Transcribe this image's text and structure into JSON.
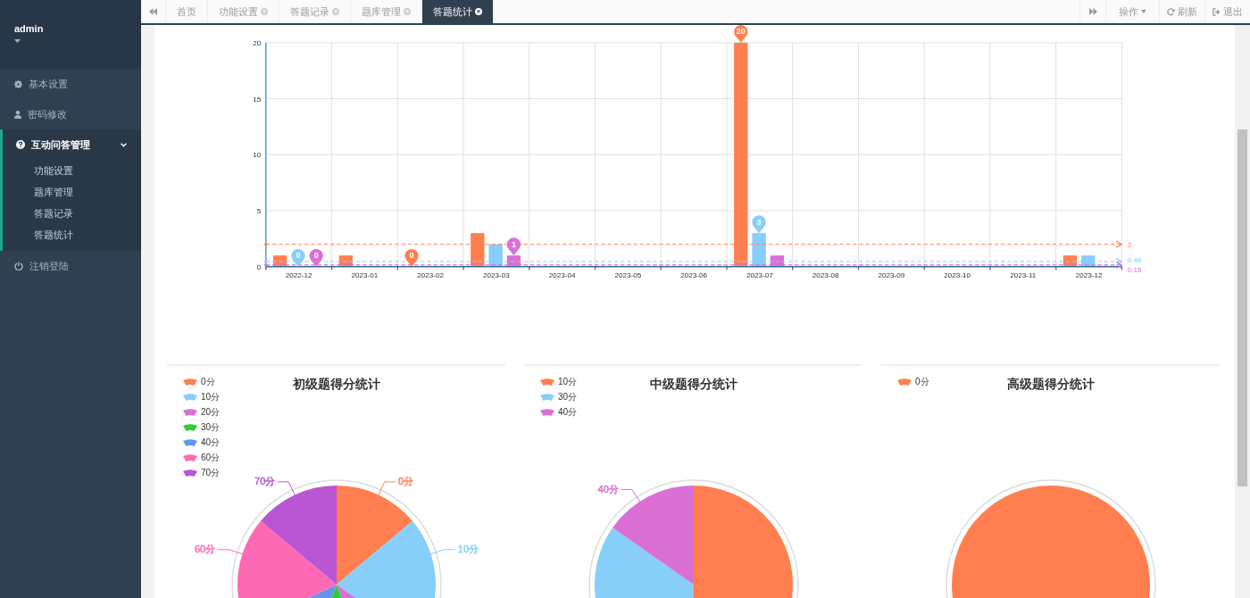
{
  "sidebar": {
    "user": {
      "name": "admin"
    },
    "items": [
      {
        "label": "基本设置",
        "kind": "link"
      },
      {
        "label": "密码修改",
        "kind": "link"
      },
      {
        "label": "互动问答管理",
        "kind": "group",
        "expanded": true,
        "children": [
          {
            "label": "功能设置"
          },
          {
            "label": "题库管理"
          },
          {
            "label": "答题记录"
          },
          {
            "label": "答题统计"
          }
        ]
      },
      {
        "label": "注销登陆",
        "kind": "link"
      }
    ]
  },
  "tabs": [
    {
      "label": "首页",
      "closable": false,
      "selected": false
    },
    {
      "label": "功能设置",
      "closable": true,
      "selected": false
    },
    {
      "label": "答题记录",
      "closable": true,
      "selected": false
    },
    {
      "label": "题库管理",
      "closable": true,
      "selected": false
    },
    {
      "label": "答题统计",
      "closable": true,
      "selected": true
    }
  ],
  "toolbar": {
    "actions_label": "操作",
    "refresh_label": "刷新",
    "logout_label": "退出"
  },
  "bar_chart": {
    "chart_data": {
      "type": "bar",
      "categories": [
        "2022-12",
        "2023-01",
        "2023-02",
        "2023-03",
        "2023-04",
        "2023-05",
        "2023-06",
        "2023-07",
        "2023-08",
        "2023-09",
        "2023-10",
        "2023-11",
        "2023-12"
      ],
      "series": [
        {
          "color": "#ff7f50",
          "values": [
            1,
            1,
            0,
            3,
            0,
            0,
            0,
            20,
            0,
            0,
            0,
            0,
            1
          ]
        },
        {
          "color": "#87cefa",
          "values": [
            0,
            0,
            0,
            2,
            0,
            0,
            0,
            3,
            0,
            0,
            0,
            0,
            1
          ]
        },
        {
          "color": "#da70d6",
          "values": [
            0,
            0,
            0,
            1,
            0,
            0,
            0,
            1,
            0,
            0,
            0,
            0,
            0
          ]
        }
      ],
      "ylim": [
        0,
        20
      ],
      "yticks": [
        0,
        5,
        10,
        15,
        20
      ],
      "grid": true,
      "annotations": [
        "20",
        "0",
        "3",
        "0",
        "1",
        "0"
      ],
      "ref_lines": [
        {
          "axis": "y",
          "value": 2,
          "label": "2",
          "color": "#ff7f50"
        },
        {
          "axis": "y",
          "value": 0.46,
          "label": "0.46",
          "color": "#87cefa"
        },
        {
          "axis": "y",
          "value": 0.15,
          "label": "0.15",
          "color": "#da70d6"
        }
      ]
    }
  },
  "pies": [
    {
      "title": "初级题得分统计",
      "legend": [
        {
          "label": "0分",
          "color": "#ff7f50"
        },
        {
          "label": "10分",
          "color": "#87cefa"
        },
        {
          "label": "20分",
          "color": "#da70d6"
        },
        {
          "label": "30分",
          "color": "#32cd32"
        },
        {
          "label": "40分",
          "color": "#6495ed"
        },
        {
          "label": "60分",
          "color": "#ff69b4"
        },
        {
          "label": "70分",
          "color": "#ba55d3"
        }
      ],
      "slice_labels": [
        {
          "text": "0分",
          "color": "#ff7f50"
        },
        {
          "text": "10分",
          "color": "#87cefa"
        },
        {
          "text": "60分",
          "color": "#ff69b4"
        },
        {
          "text": "70分",
          "color": "#ba55d3"
        }
      ]
    },
    {
      "title": "中级题得分统计",
      "legend": [
        {
          "label": "10分",
          "color": "#ff7f50"
        },
        {
          "label": "30分",
          "color": "#87cefa"
        },
        {
          "label": "40分",
          "color": "#da70d6"
        }
      ],
      "slice_labels": [
        {
          "text": "40分",
          "color": "#da70d6"
        }
      ]
    },
    {
      "title": "高级题得分统计",
      "legend": [
        {
          "label": "0分",
          "color": "#ff7f50"
        }
      ]
    }
  ]
}
